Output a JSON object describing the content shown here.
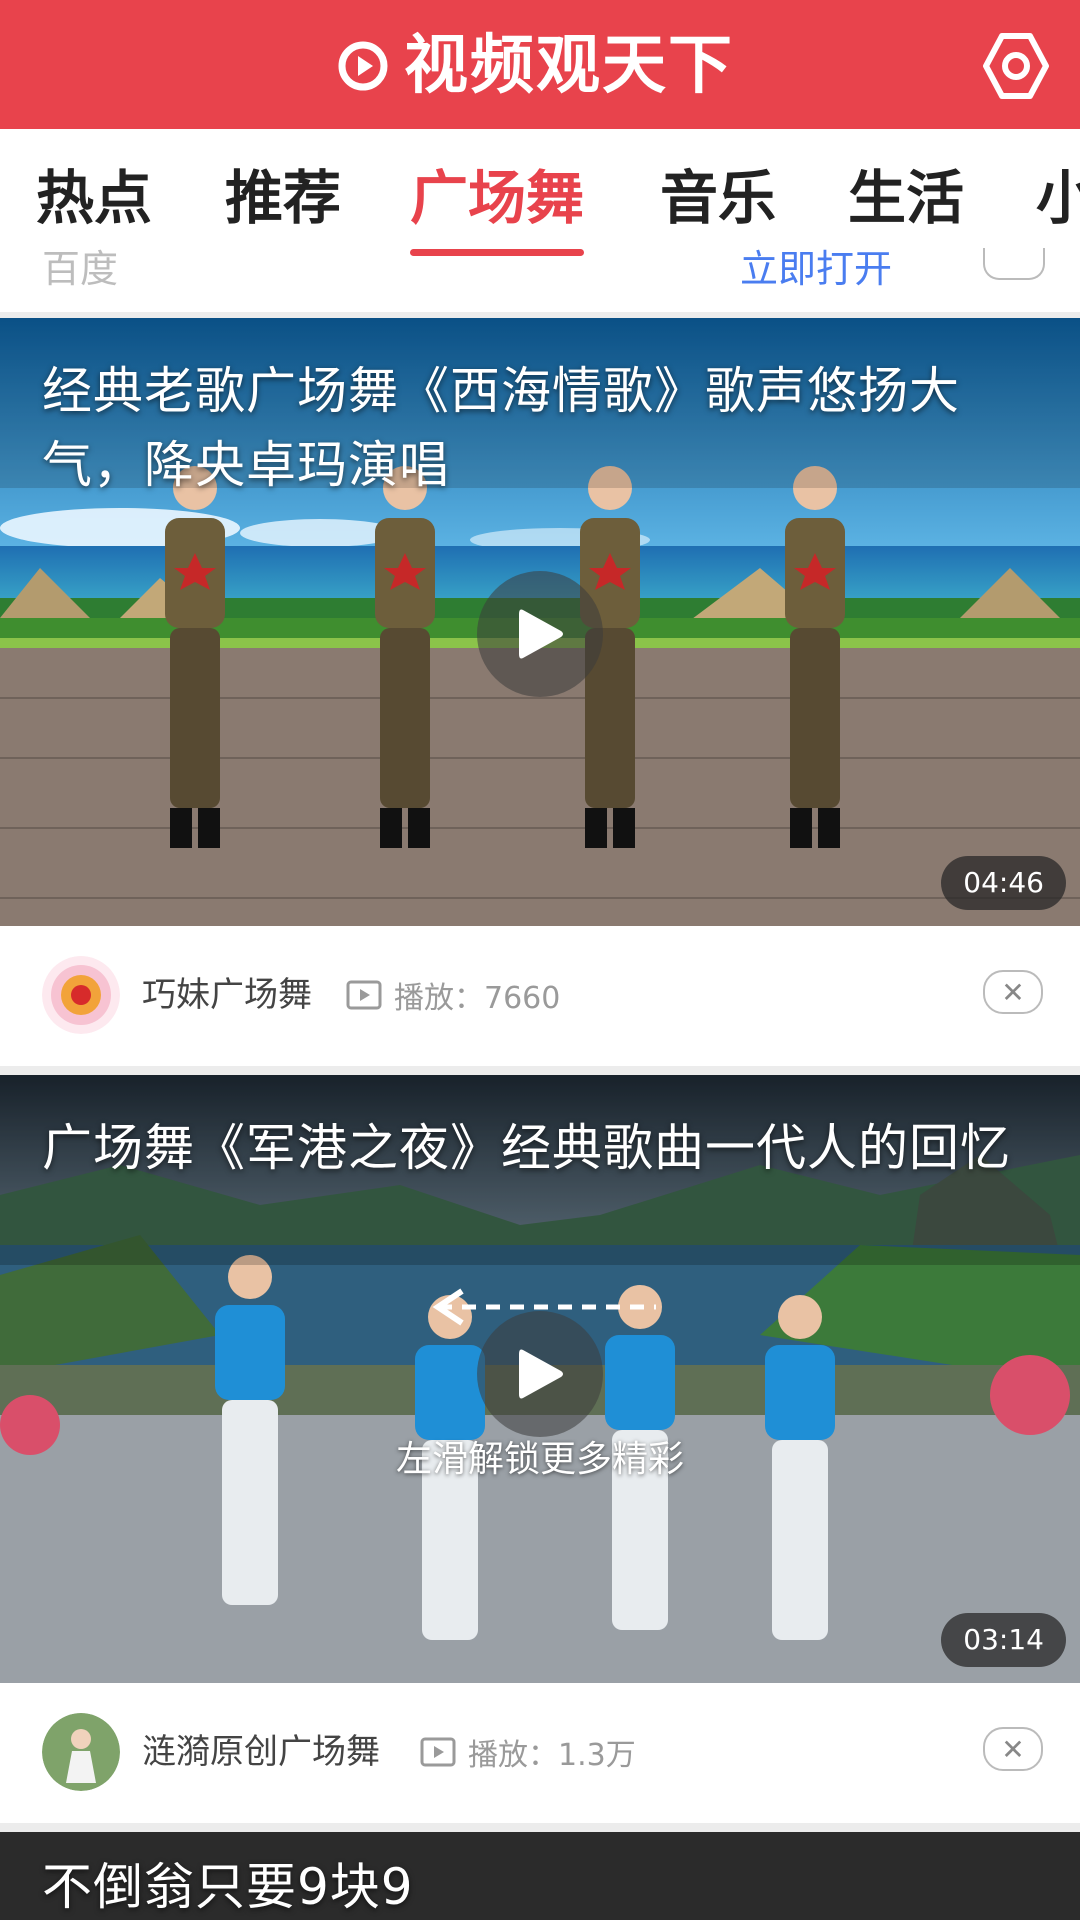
{
  "header": {
    "title": "视频观天下",
    "brand_icon": "play-circle-icon",
    "settings_icon": "settings-icon",
    "color": "#e8434c"
  },
  "tabs": [
    {
      "label": "热点",
      "active": false
    },
    {
      "label": "推荐",
      "active": false
    },
    {
      "label": "广场舞",
      "active": true
    },
    {
      "label": "音乐",
      "active": false
    },
    {
      "label": "生活",
      "active": false
    },
    {
      "label": "小",
      "active": false
    }
  ],
  "ad_remnant": {
    "source": "百度",
    "open_label": "立即打开"
  },
  "videos": [
    {
      "title": "经典老歌广场舞《西海情歌》歌声悠扬大气，降央卓玛演唱",
      "duration": "04:46",
      "author": "巧妹广场舞",
      "plays": "播放：7660"
    },
    {
      "title": "广场舞《军港之夜》经典歌曲一代人的回忆",
      "duration": "03:14",
      "author": "涟漪原创广场舞",
      "plays": "播放：1.3万",
      "hint": "左滑解锁更多精彩"
    },
    {
      "title": "不倒翁只要9块9"
    }
  ]
}
